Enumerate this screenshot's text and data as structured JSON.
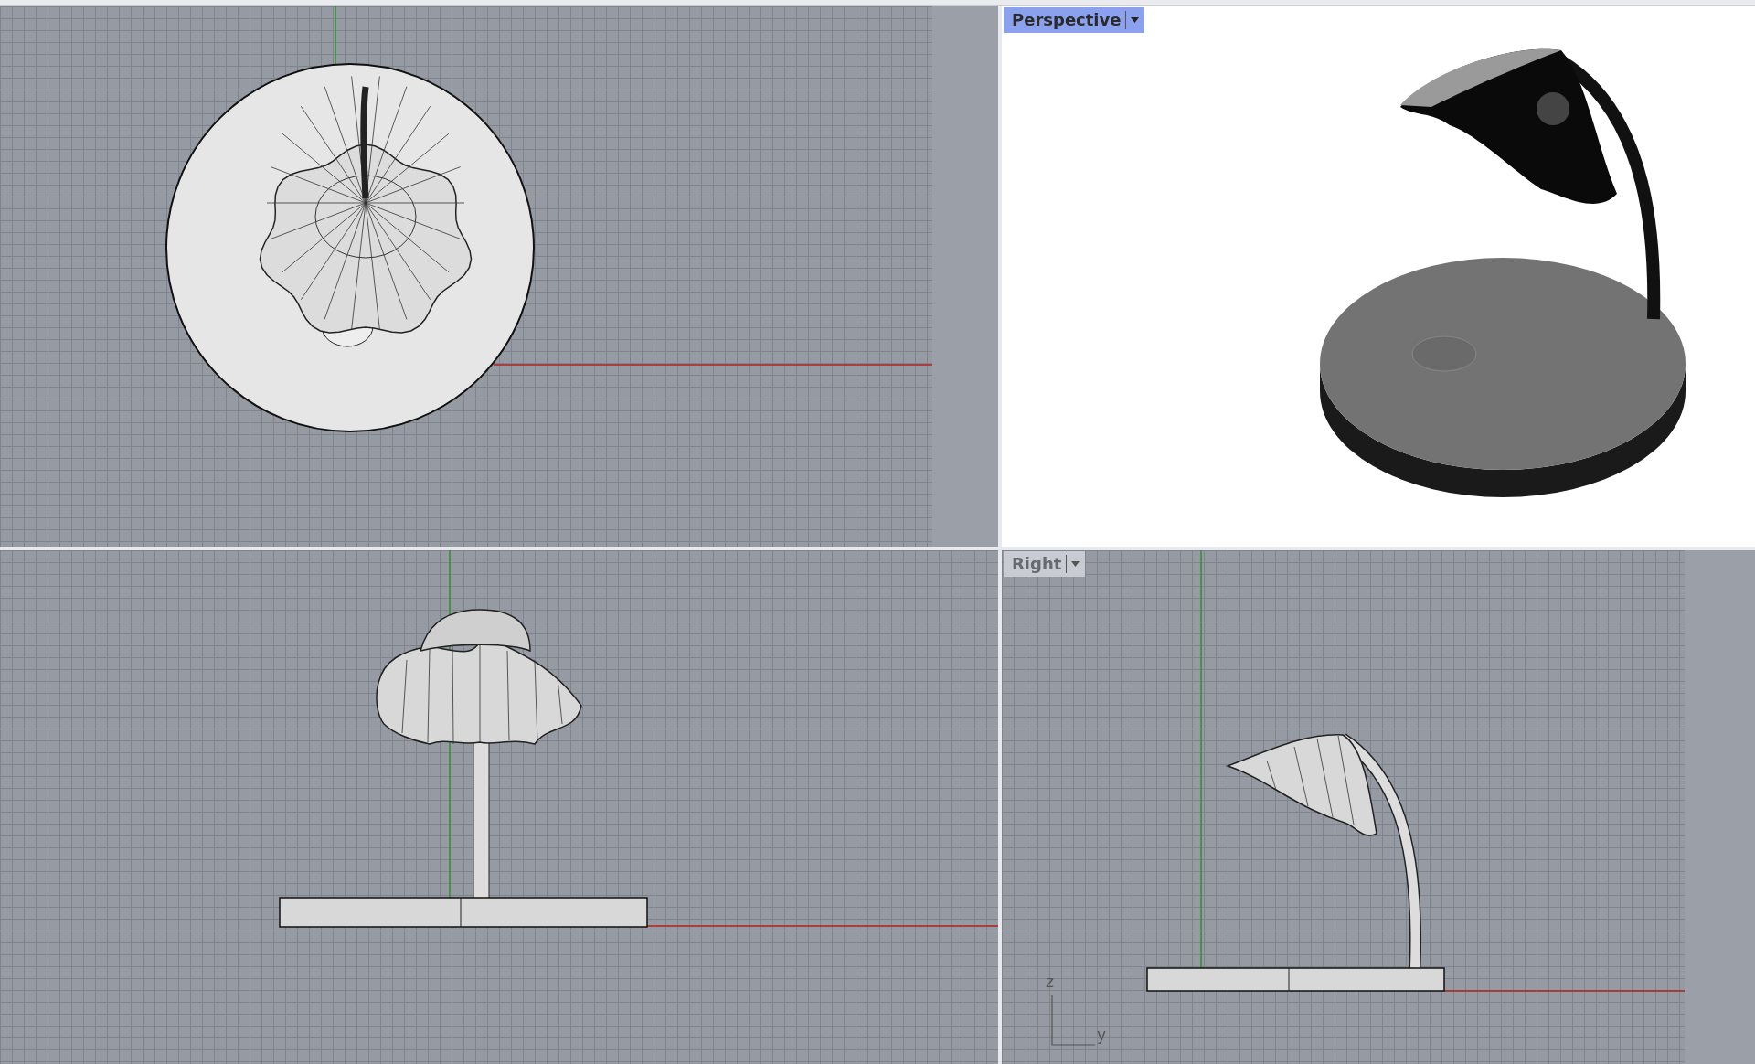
{
  "viewports": [
    {
      "kind": "top"
    },
    {
      "kind": "perspective",
      "title": "Perspective",
      "selected": true
    },
    {
      "kind": "front"
    },
    {
      "kind": "right",
      "title": "Right",
      "selected": false,
      "axis_labels": [
        "z",
        "y"
      ]
    }
  ]
}
